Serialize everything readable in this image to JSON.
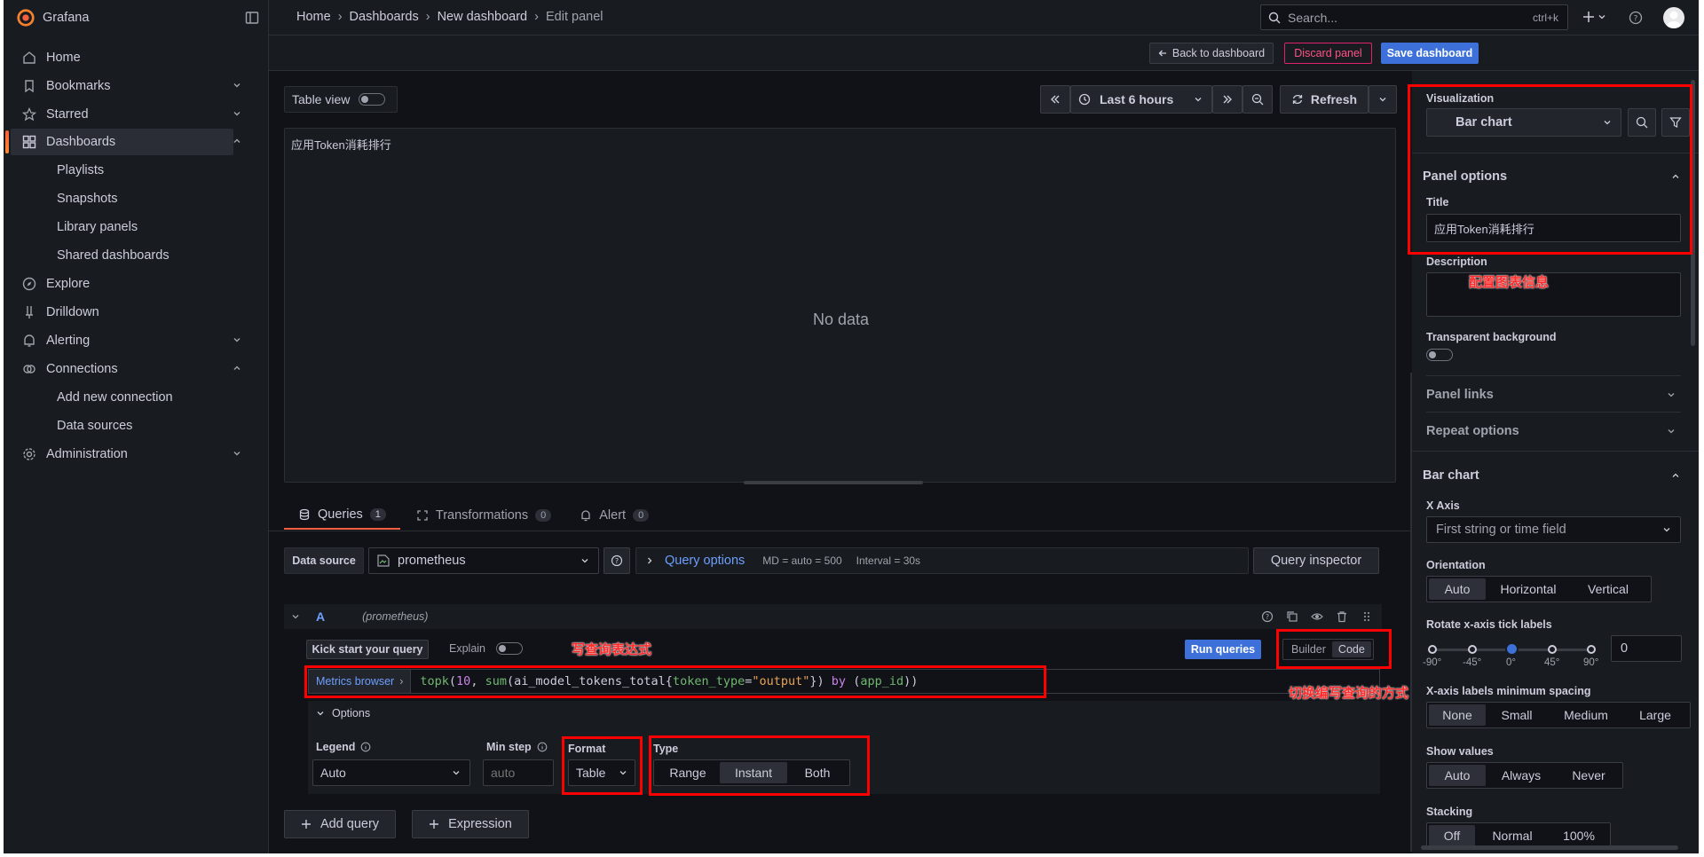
{
  "app": {
    "name": "Grafana"
  },
  "sidebar": {
    "items": [
      {
        "label": "Home"
      },
      {
        "label": "Bookmarks"
      },
      {
        "label": "Starred"
      },
      {
        "label": "Dashboards"
      },
      {
        "label": "Playlists"
      },
      {
        "label": "Snapshots"
      },
      {
        "label": "Library panels"
      },
      {
        "label": "Shared dashboards"
      },
      {
        "label": "Explore"
      },
      {
        "label": "Drilldown"
      },
      {
        "label": "Alerting"
      },
      {
        "label": "Connections"
      },
      {
        "label": "Add new connection"
      },
      {
        "label": "Data sources"
      },
      {
        "label": "Administration"
      }
    ]
  },
  "breadcrumb": {
    "items": [
      "Home",
      "Dashboards",
      "New dashboard",
      "Edit panel"
    ],
    "sep": "›"
  },
  "search": {
    "placeholder": "Search...",
    "shortcut": "ctrl+k"
  },
  "toolbar": {
    "back": "Back to dashboard",
    "discard": "Discard panel",
    "save": "Save dashboard"
  },
  "preview": {
    "table_view": "Table view",
    "time_range": "Last 6 hours",
    "refresh": "Refresh",
    "panel_title": "应用Token消耗排行",
    "no_data": "No data"
  },
  "tabs": [
    {
      "label": "Queries",
      "count": "1"
    },
    {
      "label": "Transformations",
      "count": "0"
    },
    {
      "label": "Alert",
      "count": "0"
    }
  ],
  "datasource": {
    "label": "Data source",
    "value": "prometheus",
    "query_options": "Query options",
    "md": "MD = auto = 500",
    "interval": "Interval = 30s",
    "inspector": "Query inspector"
  },
  "query": {
    "ref": "A",
    "ds": "(prometheus)",
    "kick_start": "Kick start your query",
    "explain": "Explain",
    "run": "Run queries",
    "builder": "Builder",
    "code": "Code",
    "metrics_browser": "Metrics browser",
    "expr_parts": [
      "topk",
      "(",
      "10",
      ", ",
      "sum",
      "(",
      "ai_model_tokens_total",
      "{",
      "token_type",
      "=",
      "\"output\"",
      "}",
      ")",
      " by ",
      "(",
      "app_id",
      "))"
    ],
    "options": "Options",
    "legend_label": "Legend",
    "legend_value": "Auto",
    "min_step_label": "Min step",
    "min_step_placeholder": "auto",
    "format_label": "Format",
    "format_value": "Table",
    "type_label": "Type",
    "type_options": [
      "Range",
      "Instant",
      "Both"
    ]
  },
  "add": {
    "query": "Add query",
    "expression": "Expression"
  },
  "annotations": {
    "query": "写查询表达式",
    "mode": "切换编写查询的方式",
    "panel": "配置图表信息"
  },
  "options_pane": {
    "viz_label": "Visualization",
    "viz_value": "Bar chart",
    "panel_options": "Panel options",
    "title_label": "Title",
    "title_value": "应用Token消耗排行",
    "description_label": "Description",
    "transparent_label": "Transparent background",
    "panel_links": "Panel links",
    "repeat_options": "Repeat options",
    "bar_chart": "Bar chart",
    "x_axis_label": "X Axis",
    "x_axis_value": "First string or time field",
    "orientation_label": "Orientation",
    "orientation_options": [
      "Auto",
      "Horizontal",
      "Vertical"
    ],
    "rotate_label": "Rotate x-axis tick labels",
    "rotate_ticks": [
      "-90°",
      "-45°",
      "0°",
      "45°",
      "90°"
    ],
    "rotate_value": "0",
    "spacing_label": "X-axis labels minimum spacing",
    "spacing_options": [
      "None",
      "Small",
      "Medium",
      "Large"
    ],
    "show_values_label": "Show values",
    "show_values_options": [
      "Auto",
      "Always",
      "Never"
    ],
    "stacking_label": "Stacking",
    "stacking_options": [
      "Off",
      "Normal",
      "100%"
    ]
  },
  "colors": {
    "primary": "#3d71d9",
    "annotation": "#ff0000",
    "accent": "#f55f3e"
  }
}
